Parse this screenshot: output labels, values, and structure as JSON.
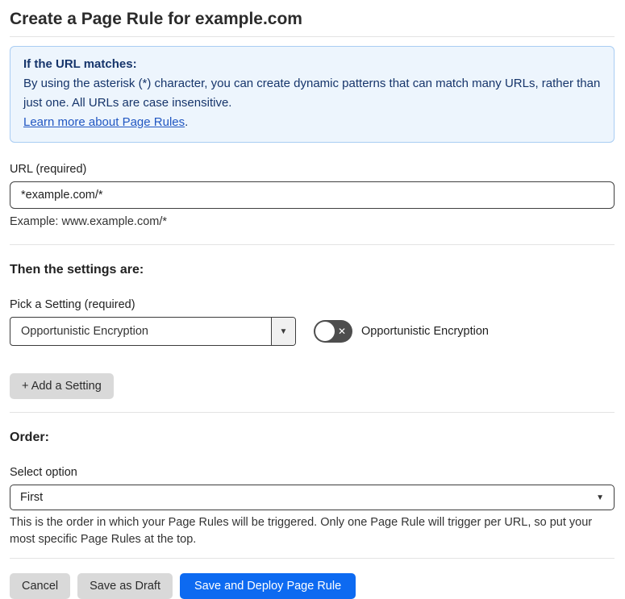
{
  "page": {
    "title": "Create a Page Rule for example.com"
  },
  "info_box": {
    "heading": "If the URL matches:",
    "body": "By using the asterisk (*) character, you can create dynamic patterns that can match many URLs, rather than just one. All URLs are case insensitive.",
    "link_label": "Learn more about Page Rules",
    "link_suffix": "."
  },
  "url_field": {
    "label": "URL (required)",
    "value": "*example.com/*",
    "helper": "Example: www.example.com/*"
  },
  "settings_section": {
    "heading": "Then the settings are:",
    "picker_label": "Pick a Setting (required)",
    "picker_value": "Opportunistic Encryption",
    "toggle_label": "Opportunistic Encryption",
    "toggle_state": "off",
    "add_setting_button": "+ Add a Setting"
  },
  "order_section": {
    "heading": "Order:",
    "select_label": "Select option",
    "select_value": "First",
    "helper": "This is the order in which your Page Rules will be triggered. Only one Page Rule will trigger per URL, so put your most specific Page Rules at the top."
  },
  "footer": {
    "cancel_label": "Cancel",
    "save_draft_label": "Save as Draft",
    "save_deploy_label": "Save and Deploy Page Rule"
  },
  "icons": {
    "chevron_down": "▼",
    "close": "✕"
  },
  "colors": {
    "primary_button": "#0d6af1",
    "info_bg": "#edf5fd",
    "info_border": "#a9cdf3",
    "info_text": "#16356b",
    "link": "#2157c2",
    "toggle_off_bg": "#4d4d4d",
    "gray_button": "#d9d9d9"
  }
}
